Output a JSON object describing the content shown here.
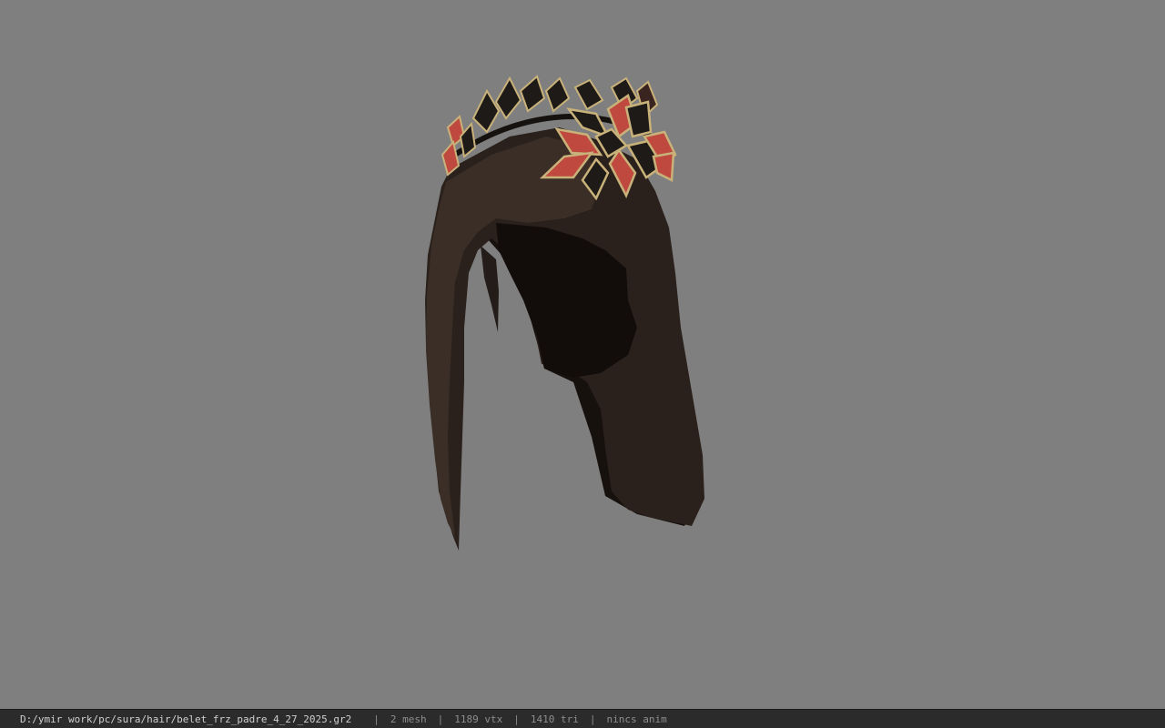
{
  "viewport": {
    "background_color": "#7f7f7f",
    "model": {
      "name": "hair-model-with-laurel-crown",
      "hair_color": "#2a211c",
      "crown_leaf_dark": "#1e1a17",
      "crown_leaf_red": "#c0493f",
      "crown_trim_gold": "#c9b27a"
    }
  },
  "status_bar": {
    "file_path": "D:/ymir work/pc/sura/hair/belet_frz_padre_4_27_2025.gr2",
    "separator": "|",
    "mesh_count": "2 mesh",
    "vertex_count": "1189 vtx",
    "triangle_count": "1410 tri",
    "animation": "nincs anim"
  }
}
